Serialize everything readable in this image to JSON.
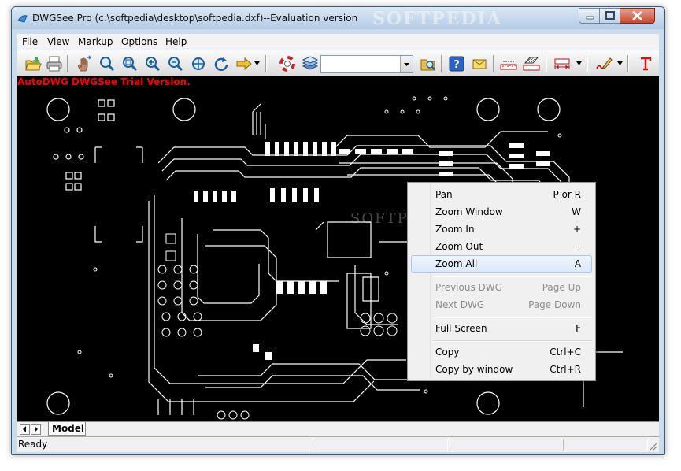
{
  "window": {
    "title": "DWGSee Pro (c:\\softpedia\\desktop\\softpedia.dxf)--Evaluation version",
    "title_watermark": "SOFTPEDIA"
  },
  "menu": {
    "items": [
      "File",
      "View",
      "Markup",
      "Options",
      "Help"
    ]
  },
  "toolbar": {
    "icons": [
      "open-folder-icon",
      "print-icon",
      "pan-hand-icon",
      "zoom-realtime-icon",
      "zoom-window-icon",
      "zoom-in-icon",
      "zoom-out-icon",
      "rotate-icon",
      "next-arrow-icon",
      "help-lifebuoy-icon",
      "layers-icon",
      "layer-folder-icon",
      "help-question-icon",
      "email-icon",
      "measure-distance-icon",
      "measure-area-icon",
      "dimension-icon",
      "markup-pen-icon",
      "text-tool-icon"
    ],
    "layer_combo_value": ""
  },
  "canvas": {
    "trial_text": "AutoDWG DWGSee Trial Version.",
    "watermark": "SOFTPEDIA"
  },
  "context_menu": {
    "items": [
      {
        "label": "Pan",
        "shortcut": "P or R",
        "enabled": true,
        "highlighted": false
      },
      {
        "label": "Zoom Window",
        "shortcut": "W",
        "enabled": true,
        "highlighted": false
      },
      {
        "label": "Zoom In",
        "shortcut": "+",
        "enabled": true,
        "highlighted": false
      },
      {
        "label": "Zoom Out",
        "shortcut": "-",
        "enabled": true,
        "highlighted": false
      },
      {
        "label": "Zoom All",
        "shortcut": "A",
        "enabled": true,
        "highlighted": true
      },
      {
        "label": "Previous DWG",
        "shortcut": "Page Up",
        "enabled": false,
        "highlighted": false
      },
      {
        "label": "Next DWG",
        "shortcut": "Page Down",
        "enabled": false,
        "highlighted": false
      },
      {
        "label": "Full Screen",
        "shortcut": "F",
        "enabled": true,
        "highlighted": false
      },
      {
        "label": "Copy",
        "shortcut": "Ctrl+C",
        "enabled": true,
        "highlighted": false
      },
      {
        "label": "Copy by window",
        "shortcut": "Ctrl+R",
        "enabled": true,
        "highlighted": false
      }
    ]
  },
  "tabs": {
    "active": "Model"
  },
  "status": {
    "text": "Ready"
  },
  "colors": {
    "canvas_bg": "#000000",
    "drawing_lines": "#ffffff",
    "trial_text": "#ff0000",
    "menu_highlight": "#dde9f8"
  }
}
